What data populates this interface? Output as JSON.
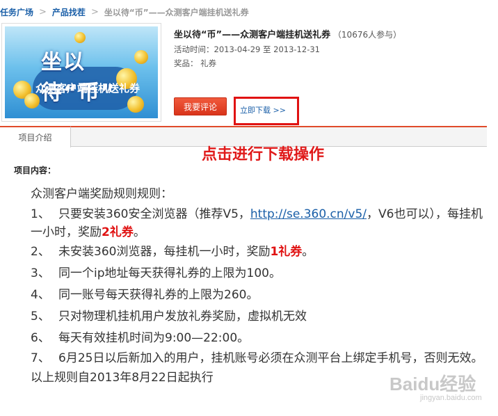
{
  "breadcrumb": {
    "items": [
      "任务广场",
      "产品找茬"
    ],
    "current": "坐以待“币”——众测客户端挂机送礼券",
    "separator": ">"
  },
  "banner": {
    "title": "坐以待“币”",
    "subtitle": "众测客户端挂机送礼券"
  },
  "project": {
    "title": "坐以待“币”——众测客户端挂机送礼券",
    "participants": "（10676人参与）",
    "activity_time": "活动时间：2013-04-29 至 2013-12-31",
    "prize": "奖品：  礼券"
  },
  "actions": {
    "comment_label": "我要评论",
    "download_label": "立即下载 >>"
  },
  "tabs": [
    {
      "label": "项目介绍"
    }
  ],
  "annotation": "点击进行下载操作",
  "content": {
    "heading": "项目内容：",
    "intro": "众测客户端奖励规则规则：",
    "rules": [
      {
        "num": "1、",
        "text_a": "只要安装360安全浏览器（推荐V5，",
        "link": "http://se.360.cn/v5/",
        "text_b": "，V6也可以），每挂机一小时，奖励",
        "highlight": "2礼券",
        "text_c": "。"
      },
      {
        "num": "2、",
        "text_a": "未安装360浏览器，每挂机一小时，奖励",
        "highlight": "1礼券",
        "text_c": "。"
      },
      {
        "num": "3、",
        "text": "同一个ip地址每天获得礼券的上限为100。"
      },
      {
        "num": "4、",
        "text": "同一账号每天获得礼券的上限为260。"
      },
      {
        "num": "5、",
        "text": "只对物理机挂机用户发放礼券奖励，虚拟机无效"
      },
      {
        "num": "6、",
        "text": "每天有效挂机时间为9:00—22:00。"
      },
      {
        "num": "7、",
        "text": "6月25日以后新加入的用户，挂机账号必须在众测平台上绑定手机号，否则无效。"
      }
    ],
    "footer": "以上规则自2013年8月22日起执行"
  },
  "watermark": {
    "brand": "Baidu经验",
    "url": "jingyan.baidu.com"
  },
  "colors": {
    "accent_red": "#e01212",
    "link_blue": "#1a5fa8",
    "button_red": "#d9341b"
  }
}
